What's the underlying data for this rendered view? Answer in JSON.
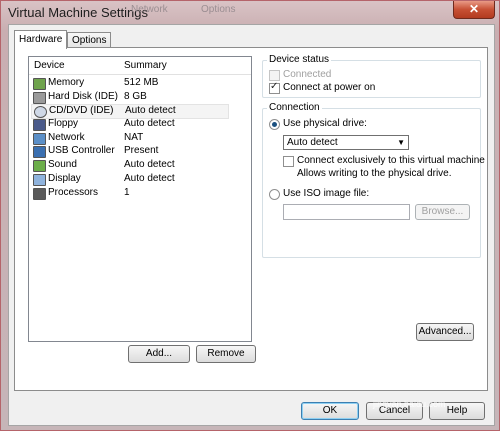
{
  "window": {
    "title": "Virtual Machine Settings",
    "background_tab_texts": [
      "Network",
      "Options"
    ],
    "close_glyph": "✕"
  },
  "tabs": [
    {
      "label": "Hardware",
      "active": true
    },
    {
      "label": "Options",
      "active": false
    }
  ],
  "device_list": {
    "columns": [
      "Device",
      "Summary"
    ],
    "rows": [
      {
        "device": "Memory",
        "summary": "512 MB",
        "icon": "memory-icon"
      },
      {
        "device": "Hard Disk (IDE)",
        "summary": "8 GB",
        "icon": "hard-disk-icon"
      },
      {
        "device": "CD/DVD (IDE)",
        "summary": "Auto detect",
        "icon": "cd-dvd-icon",
        "selected": true
      },
      {
        "device": "Floppy",
        "summary": "Auto detect",
        "icon": "floppy-icon"
      },
      {
        "device": "Network",
        "summary": "NAT",
        "icon": "network-icon"
      },
      {
        "device": "USB Controller",
        "summary": "Present",
        "icon": "usb-icon"
      },
      {
        "device": "Sound",
        "summary": "Auto detect",
        "icon": "sound-icon"
      },
      {
        "device": "Display",
        "summary": "Auto detect",
        "icon": "display-icon"
      },
      {
        "device": "Processors",
        "summary": "1",
        "icon": "processor-icon"
      }
    ]
  },
  "list_buttons": {
    "add": "Add...",
    "remove": "Remove"
  },
  "device_status": {
    "title": "Device status",
    "connected": {
      "label": "Connected",
      "checked": false,
      "disabled": true
    },
    "connect_power_on": {
      "label": "Connect at power on",
      "checked": true
    }
  },
  "connection": {
    "title": "Connection",
    "physical": {
      "label": "Use physical drive:",
      "selected": true
    },
    "drive_select": {
      "value": "Auto detect"
    },
    "exclusive": {
      "label": "Connect exclusively to this virtual machine",
      "checked": false
    },
    "exclusive_note": "Allows writing to the physical drive.",
    "iso": {
      "label": "Use ISO image file:",
      "selected": false
    },
    "iso_path": "",
    "browse": "Browse..."
  },
  "advanced_button": "Advanced...",
  "dialog_buttons": {
    "ok": "OK",
    "cancel": "Cancel",
    "help": "Help"
  },
  "watermark": {
    "logo": "Bai du 经验",
    "url": "jingyan.baidu.com"
  },
  "colors": {
    "title_bar": "#d9c3c5",
    "close_button": "#c75034",
    "radio_dot": "#1c5180"
  }
}
